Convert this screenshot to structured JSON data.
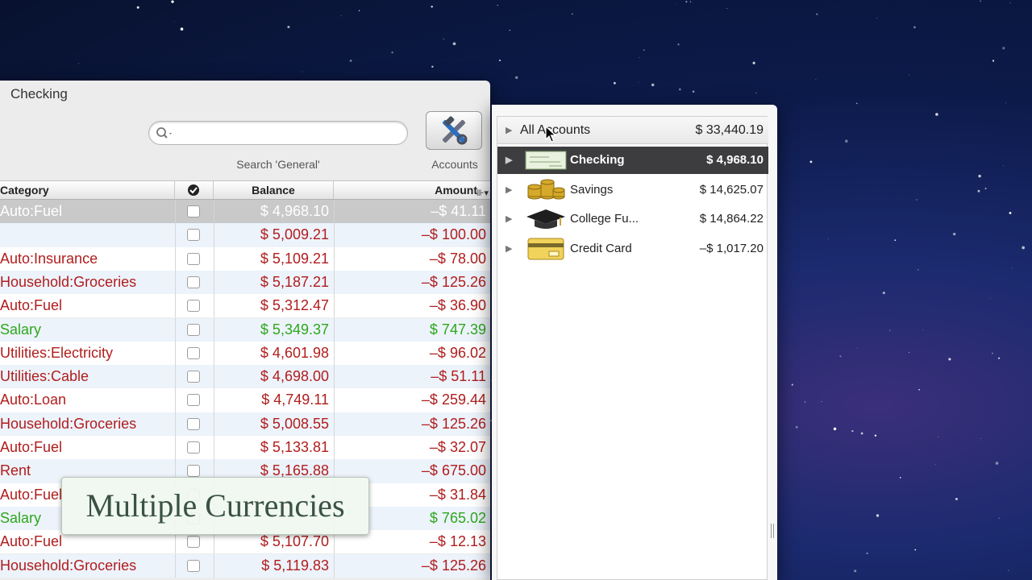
{
  "register": {
    "title": "Checking",
    "search": {
      "placeholder": "",
      "label": "Search 'General'"
    },
    "accounts_button_label": "Accounts",
    "columns": {
      "category": "Category",
      "balance": "Balance",
      "amount": "Amount"
    },
    "rows": [
      {
        "category": "Auto:Fuel",
        "balance": "$ 4,968.10",
        "amount": "–$ 41.11",
        "kind": "neg",
        "selected": true
      },
      {
        "category": "",
        "balance": "$ 5,009.21",
        "amount": "–$ 100.00",
        "kind": "neg"
      },
      {
        "category": "Auto:Insurance",
        "balance": "$ 5,109.21",
        "amount": "–$ 78.00",
        "kind": "neg"
      },
      {
        "category": "Household:Groceries",
        "balance": "$ 5,187.21",
        "amount": "–$ 125.26",
        "kind": "neg"
      },
      {
        "category": "Auto:Fuel",
        "balance": "$ 5,312.47",
        "amount": "–$ 36.90",
        "kind": "neg"
      },
      {
        "category": "Salary",
        "balance": "$ 5,349.37",
        "amount": "$ 747.39",
        "kind": "pos"
      },
      {
        "category": "Utilities:Electricity",
        "balance": "$ 4,601.98",
        "amount": "–$ 96.02",
        "kind": "neg"
      },
      {
        "category": "Utilities:Cable",
        "balance": "$ 4,698.00",
        "amount": "–$ 51.11",
        "kind": "neg"
      },
      {
        "category": "Auto:Loan",
        "balance": "$ 4,749.11",
        "amount": "–$ 259.44",
        "kind": "neg"
      },
      {
        "category": "Household:Groceries",
        "balance": "$ 5,008.55",
        "amount": "–$ 125.26",
        "kind": "neg"
      },
      {
        "category": "Auto:Fuel",
        "balance": "$ 5,133.81",
        "amount": "–$ 32.07",
        "kind": "neg"
      },
      {
        "category": "Rent",
        "balance": "$ 5,165.88",
        "amount": "–$ 675.00",
        "kind": "neg"
      },
      {
        "category": "Auto:Fuel",
        "balance": "",
        "amount": "–$ 31.84",
        "kind": "neg"
      },
      {
        "category": "Salary",
        "balance": "",
        "amount": "$ 765.02",
        "kind": "pos"
      },
      {
        "category": "Auto:Fuel",
        "balance": "$ 5,107.70",
        "amount": "–$ 12.13",
        "kind": "neg"
      },
      {
        "category": "Household:Groceries",
        "balance": "$ 5,119.83",
        "amount": "–$ 125.26",
        "kind": "neg"
      }
    ]
  },
  "caption": "Multiple Currencies",
  "accounts": {
    "all": {
      "name": "All Accounts",
      "balance": "$ 33,440.19"
    },
    "items": [
      {
        "name": "Checking",
        "balance": "$ 4,968.10",
        "icon": "checkbook-icon",
        "selected": true
      },
      {
        "name": "Savings",
        "balance": "$ 14,625.07",
        "icon": "coins-icon"
      },
      {
        "name": "College Fu...",
        "balance": "$ 14,864.22",
        "icon": "graduation-cap-icon"
      },
      {
        "name": "Credit Card",
        "balance": "–$ 1,017.20",
        "icon": "credit-card-icon"
      }
    ]
  },
  "colors": {
    "negative": "#b01d1d",
    "positive": "#2ea71d",
    "selected_account": "#3d3d40"
  }
}
